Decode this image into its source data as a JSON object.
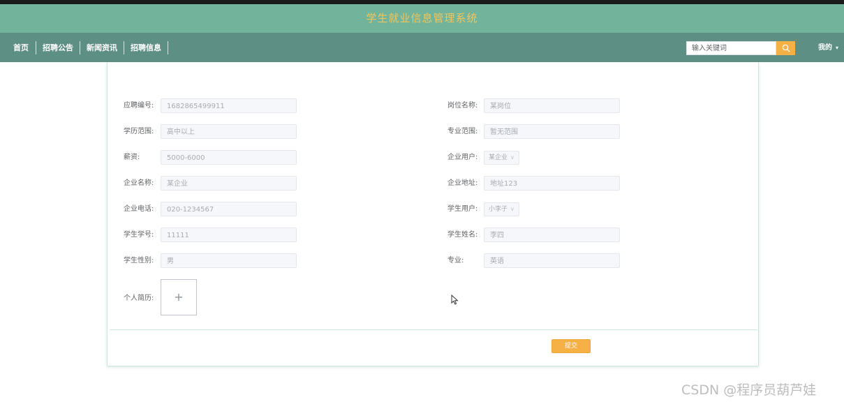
{
  "header": {
    "title": "学生就业信息管理系统"
  },
  "nav": {
    "items": [
      {
        "label": "首页"
      },
      {
        "label": "招聘公告"
      },
      {
        "label": "新闻资讯"
      },
      {
        "label": "招聘信息"
      }
    ],
    "search": {
      "placeholder": "输入关键词",
      "value": ""
    },
    "user_menu": {
      "label": "我的"
    }
  },
  "form": {
    "fields": {
      "app_no": {
        "label": "应聘编号:",
        "value": "1682865499911"
      },
      "position_name": {
        "label": "岗位名称:",
        "value": "某岗位"
      },
      "education": {
        "label": "学历范围:",
        "value": "高中以上"
      },
      "major_range": {
        "label": "专业范围:",
        "value": "暂无范围"
      },
      "salary": {
        "label": "薪资:",
        "value": "5000-6000"
      },
      "company_user": {
        "label": "企业用户:",
        "value": "某企业"
      },
      "company_name": {
        "label": "企业名称:",
        "value": "某企业"
      },
      "company_address": {
        "label": "企业地址:",
        "value": "地址123"
      },
      "company_phone": {
        "label": "企业电话:",
        "value": "020-1234567"
      },
      "student_user": {
        "label": "学生用户:",
        "value": "小李子"
      },
      "student_id": {
        "label": "学生学号:",
        "value": "11111"
      },
      "student_name": {
        "label": "学生姓名:",
        "value": "李四"
      },
      "student_gender": {
        "label": "学生性别:",
        "value": "男"
      },
      "major": {
        "label": "专业:",
        "value": "英语"
      },
      "resume": {
        "label": "个人简历:",
        "upload_symbol": "+"
      }
    },
    "submit_label": "提交"
  },
  "watermark": "CSDN @程序员葫芦娃",
  "colors": {
    "title_bar": "#72b39b",
    "title_text": "#f2c55c",
    "nav_bar": "#5e8f84",
    "accent": "#f5b146"
  },
  "icons": {
    "search": "search-icon",
    "caret": "chevron-down-icon",
    "upload": "plus-icon",
    "cursor": "mouse-pointer-icon"
  }
}
